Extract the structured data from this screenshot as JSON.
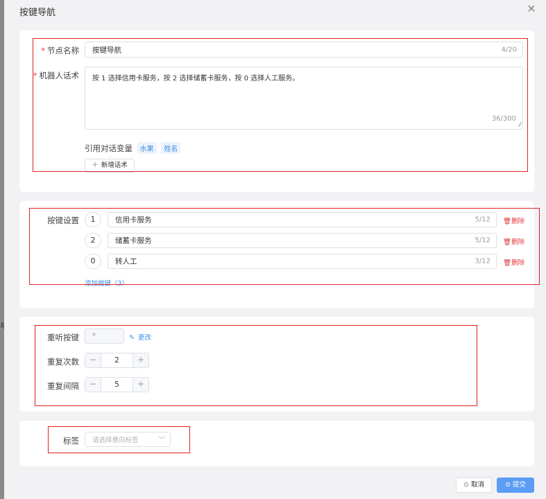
{
  "dialog": {
    "title": "按键导航",
    "close_icon": "close-icon"
  },
  "left_fragment": "与",
  "node": {
    "name_label": "节点名称",
    "name_value": "按键导航",
    "name_count": "4/20",
    "script_label": "机器人话术",
    "script_value": "按 1 选择信用卡服务，按 2 选择储蓄卡服务，按 0 选择人工服务。",
    "script_count": "36/300",
    "vars_label": "引用对话变量",
    "vars": [
      "水果",
      "姓名"
    ],
    "add_script_button": "新增话术"
  },
  "keys": {
    "label": "按键设置",
    "items": [
      {
        "key": "1",
        "text": "信用卡服务",
        "count": "5/12",
        "delete": "删除"
      },
      {
        "key": "2",
        "text": "储蓄卡服务",
        "count": "5/12",
        "delete": "删除"
      },
      {
        "key": "0",
        "text": "转人工",
        "count": "3/12",
        "delete": "删除"
      }
    ],
    "add_link": "添加按键（3）"
  },
  "repeat": {
    "relisten_label": "重听按键",
    "relisten_value": "*",
    "change_link": "更改",
    "times_label": "重复次数",
    "times_value": "2",
    "interval_label": "重复间隔",
    "interval_value": "5"
  },
  "tags": {
    "label": "标签",
    "placeholder": "请选择意向标签"
  },
  "footer": {
    "cancel": "取消",
    "submit": "提交"
  },
  "colors": {
    "primary": "#5b9cf5",
    "danger": "#e0393e",
    "highlight_box": "#e02020"
  }
}
